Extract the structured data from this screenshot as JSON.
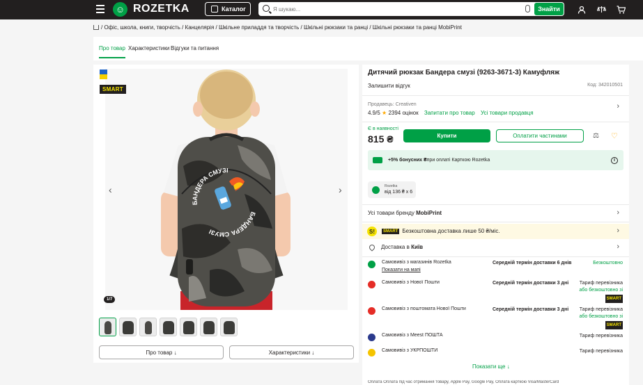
{
  "header": {
    "logo_text": "ROZETKA",
    "catalog_label": "Каталог",
    "search_placeholder": "Я шукаю...",
    "search_button": "Знайти"
  },
  "breadcrumbs": "/ Офіс, школа, книги, творчість / Канцелярія / Шкільне приладдя та творчість / Шкільні рюкзаки та ранці / Шкільні рюкзаки та ранці MobiPrint",
  "tabs": [
    "Про товар",
    "Характеристики",
    "Відгуки та питання"
  ],
  "gallery": {
    "badge": "SMART",
    "counter": "1/7",
    "prev_label": "‹",
    "next_label": "›",
    "thumb_count": 7,
    "btn_about": "Про товар ↓",
    "btn_specs": "Характеристики ↓",
    "print_text": "БАНДЕРА СМУЗІ"
  },
  "product": {
    "title": "Дитячий рюкзак Бандера смузі (9263-3671-3) Камуфляж",
    "review_link": "Залишити відгук",
    "code": "Код: 342010501",
    "seller_label": "Продавець: Creativen",
    "rating": "4.9/5",
    "star": "★",
    "ratings_count": "2394 оцінок",
    "ask_seller": "Запитати про товар",
    "all_seller": "Усі товари продавця",
    "availability": "Є в наявності",
    "price": "815 ₴",
    "buy": "Купити",
    "pay_parts": "Оплатити частинами",
    "bonus_bold": "+5% бонусних ₴",
    "bonus_rest": " при оплаті Карткою Rozetka",
    "credit_top": "Rozetka",
    "credit_bottom": "від 136 ₴ х 6"
  },
  "rows": {
    "brand_prefix": "Усі товари бренду ",
    "brand": "MobiPrint",
    "smart_icon": "S!",
    "smart_tag": "SMART",
    "smart_text": "Безкоштовна доставка лише 50 ₴/міс.",
    "delivery_prefix": "Доставка в ",
    "delivery_city": "Київ"
  },
  "delivery": [
    {
      "name": "Самовивіз з магазинів Rozetka",
      "sub": "Показати на мапі",
      "term": "Середній термін доставки 6 днів",
      "right": "Безкоштовно",
      "right_extra": "",
      "smart": "",
      "color": "#00a046"
    },
    {
      "name": "Самовивіз з Нової Пошти",
      "sub": "",
      "term": "Середній термін доставки 3 дні",
      "right": "Тариф перевізника",
      "right_extra": "або безкоштовно зі",
      "smart": "SMART",
      "color": "#e52d27"
    },
    {
      "name": "Самовивіз з поштомата Нової Пошти",
      "sub": "",
      "term": "Середній термін доставки 3 дні",
      "right": "Тариф перевізника",
      "right_extra": "або безкоштовно зі",
      "smart": "SMART",
      "color": "#e52d27"
    },
    {
      "name": "Самовивіз з Meest ПОШТА",
      "sub": "",
      "term": "",
      "right": "Тариф перевізника",
      "right_extra": "",
      "smart": "",
      "color": "#2b3a8c"
    },
    {
      "name": "Самовивіз з УКРПОШТИ",
      "sub": "",
      "term": "",
      "right": "Тариф перевізника",
      "right_extra": "",
      "smart": "",
      "color": "#f5c400"
    }
  ],
  "show_more": "Показати ще ↓",
  "peek_text": "Оплата  Оплата під час отримання товару, Apple Pay, Google Pay, Оплата карткою Visa/MasterCard"
}
